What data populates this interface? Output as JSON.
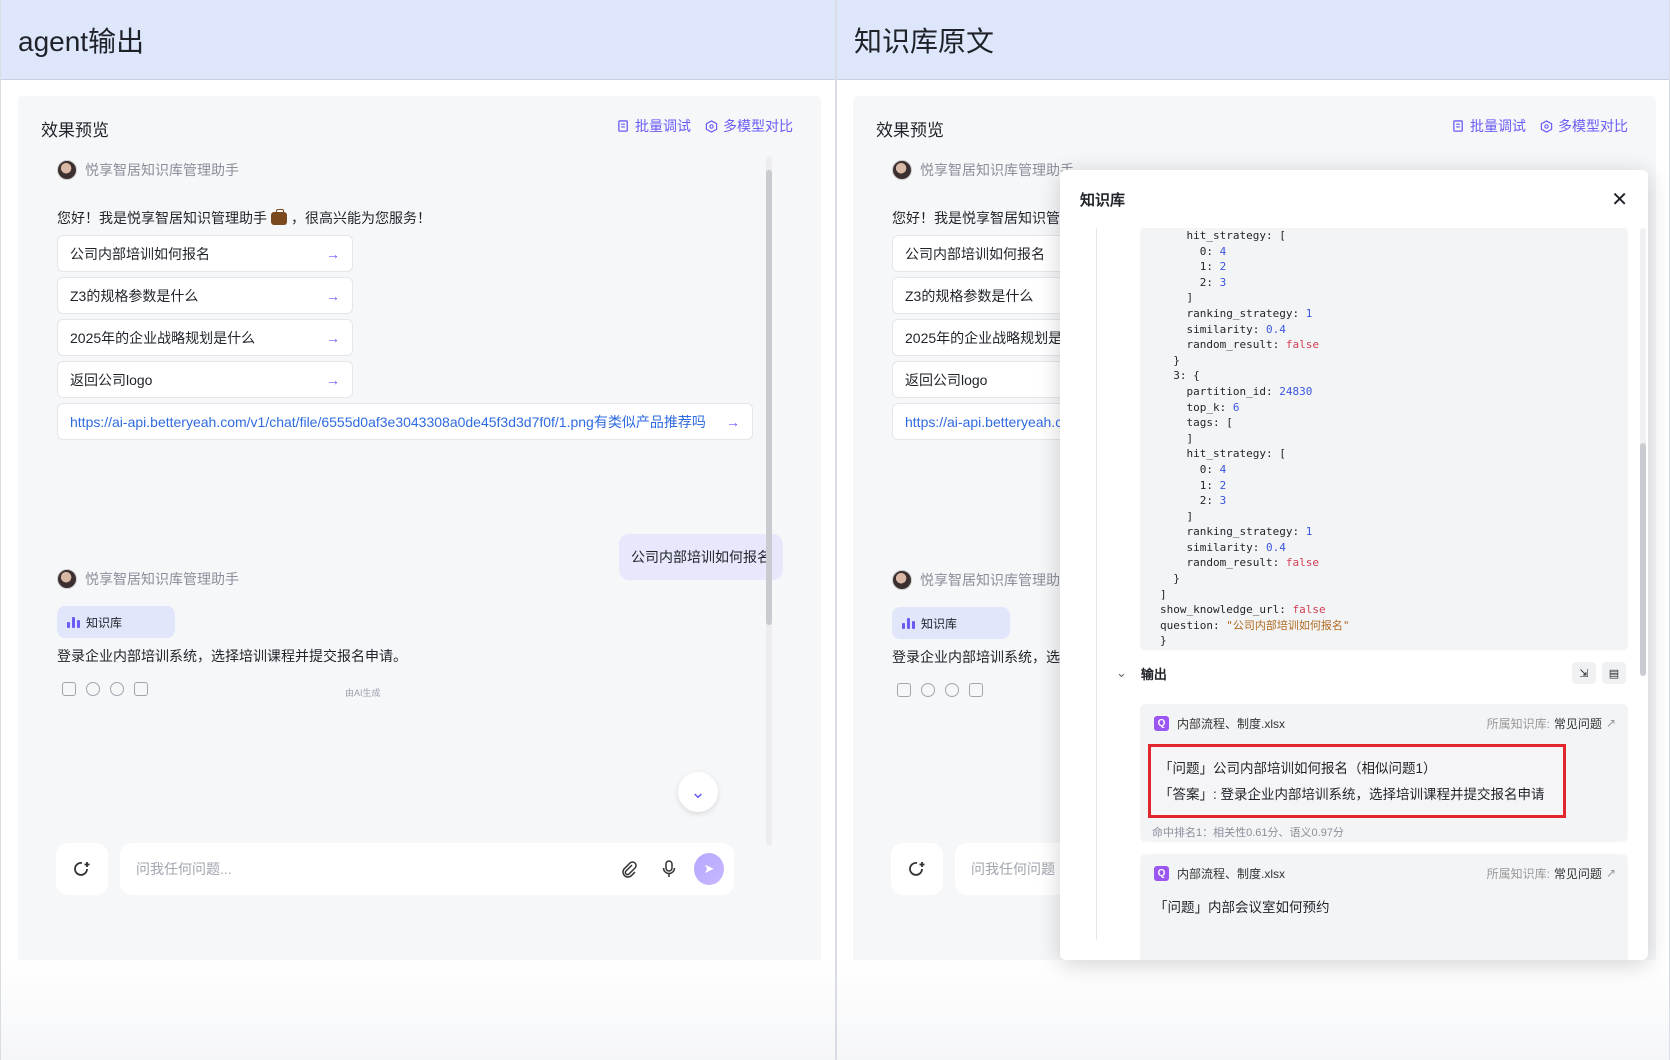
{
  "left_panel": {
    "header": "agent输出"
  },
  "right_panel": {
    "header": "知识库原文"
  },
  "preview": {
    "title": "效果预览",
    "batch_debug": "批量调试",
    "multi_model": "多模型对比",
    "bot_name": "悦享智居知识库管理助手",
    "greeting": "您好！我是悦享智居知识管理助手",
    "greeting_suffix": "，很高兴能为您服务！",
    "suggestions": [
      "公司内部培训如何报名",
      "Z3的规格参数是什么",
      "2025年的企业战略规划是什么",
      "返回公司logo"
    ],
    "suggestion_link": "https://ai-api.betteryeah.com/v1/chat/file/6555d0af3e3043308a0de45f3d3d7f0f/1.png有类似产品推荐吗",
    "suggestion_link_short": "https://ai-api.betteryeah.c",
    "user_message": "公司内部培训如何报名",
    "kb_chip": "知识库",
    "answer": "登录企业内部培训系统，选择培训课程并提交报名申请。",
    "answer_short": "登录企业内部培训系统，选抟",
    "ai_note": "由AI生成",
    "input_placeholder": "问我任何问题...",
    "input_placeholder_short": "问我任何问题"
  },
  "modal": {
    "title": "知识库",
    "code_lines": [
      [
        {
          "t": "    hit_strategy: [",
          "c": "k"
        }
      ],
      [
        {
          "t": "      0: ",
          "c": "k"
        },
        {
          "t": "4",
          "c": "v-num"
        }
      ],
      [
        {
          "t": "      1: ",
          "c": "k"
        },
        {
          "t": "2",
          "c": "v-num"
        }
      ],
      [
        {
          "t": "      2: ",
          "c": "k"
        },
        {
          "t": "3",
          "c": "v-num"
        }
      ],
      [
        {
          "t": "    ]",
          "c": "k"
        }
      ],
      [
        {
          "t": "    ranking_strategy: ",
          "c": "k"
        },
        {
          "t": "1",
          "c": "v-num"
        }
      ],
      [
        {
          "t": "    similarity: ",
          "c": "k"
        },
        {
          "t": "0.4",
          "c": "v-num"
        }
      ],
      [
        {
          "t": "    random_result: ",
          "c": "k"
        },
        {
          "t": "false",
          "c": "v-bool"
        }
      ],
      [
        {
          "t": "  }",
          "c": "k"
        }
      ],
      [
        {
          "t": "  3: {",
          "c": "k"
        }
      ],
      [
        {
          "t": "    partition_id: ",
          "c": "k"
        },
        {
          "t": "24830",
          "c": "v-num"
        }
      ],
      [
        {
          "t": "    top_k: ",
          "c": "k"
        },
        {
          "t": "6",
          "c": "v-num"
        }
      ],
      [
        {
          "t": "    tags: [",
          "c": "k"
        }
      ],
      [
        {
          "t": "    ]",
          "c": "k"
        }
      ],
      [
        {
          "t": "    hit_strategy: [",
          "c": "k"
        }
      ],
      [
        {
          "t": "      0: ",
          "c": "k"
        },
        {
          "t": "4",
          "c": "v-num"
        }
      ],
      [
        {
          "t": "      1: ",
          "c": "k"
        },
        {
          "t": "2",
          "c": "v-num"
        }
      ],
      [
        {
          "t": "      2: ",
          "c": "k"
        },
        {
          "t": "3",
          "c": "v-num"
        }
      ],
      [
        {
          "t": "    ]",
          "c": "k"
        }
      ],
      [
        {
          "t": "    ranking_strategy: ",
          "c": "k"
        },
        {
          "t": "1",
          "c": "v-num"
        }
      ],
      [
        {
          "t": "    similarity: ",
          "c": "k"
        },
        {
          "t": "0.4",
          "c": "v-num"
        }
      ],
      [
        {
          "t": "    random_result: ",
          "c": "k"
        },
        {
          "t": "false",
          "c": "v-bool"
        }
      ],
      [
        {
          "t": "  }",
          "c": "k"
        }
      ],
      [
        {
          "t": "]",
          "c": "k"
        }
      ],
      [
        {
          "t": "show_knowledge_url: ",
          "c": "k"
        },
        {
          "t": "false",
          "c": "v-bool"
        }
      ],
      [
        {
          "t": "question: ",
          "c": "k"
        },
        {
          "t": "\"公司内部培训如何报名\"",
          "c": "v-str"
        }
      ],
      [
        {
          "t": "}",
          "c": "k"
        }
      ]
    ],
    "output_label": "输出",
    "results": [
      {
        "file": "内部流程、制度.xlsx",
        "kb_label": "所属知识库:",
        "kb_name": "常见问题",
        "question": "「问题」公司内部培训如何报名（相似问题1）",
        "answer": "「答案」: 登录企业内部培训系统，选择培训课程并提交报名申请",
        "rank": "命中排名1：相关性0.61分、语义0.97分"
      },
      {
        "file": "内部流程、制度.xlsx",
        "kb_label": "所属知识库:",
        "kb_name": "常见问题",
        "question": "「问题」内部会议室如何预约"
      }
    ]
  },
  "colors": {
    "accent": "#6a5cf6",
    "header_bg": "#dde6fb",
    "highlight_border": "#e3262b",
    "link": "#2f6be0"
  }
}
